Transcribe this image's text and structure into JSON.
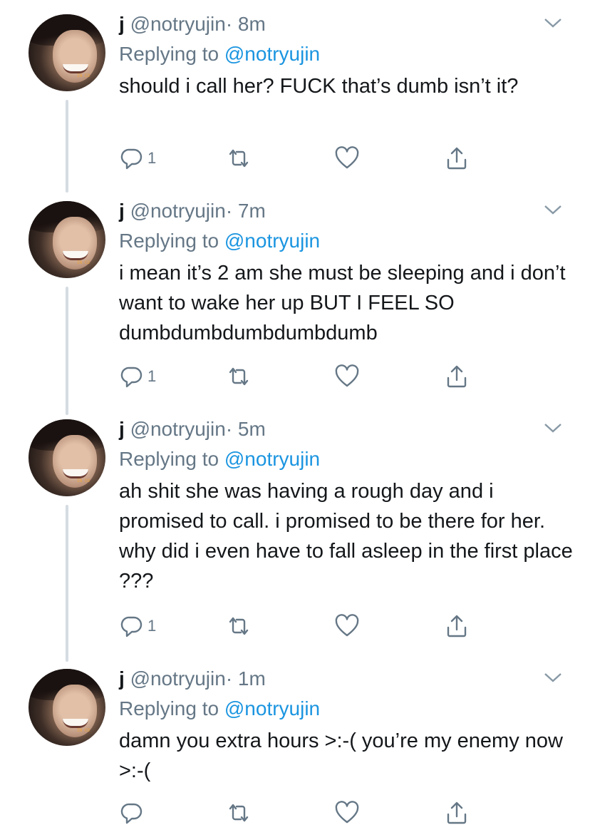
{
  "tweets": [
    {
      "name": "j",
      "handle": "@notryujin",
      "time": "· 8m",
      "replying_prefix": "Replying to",
      "replying_handle": "@notryujin",
      "text": "should i call her? FUCK that’s dumb isn’t it?",
      "reply_count": "1"
    },
    {
      "name": "j",
      "handle": "@notryujin",
      "time": "· 7m",
      "replying_prefix": "Replying to",
      "replying_handle": "@notryujin",
      "text": "i mean it’s 2 am she must be sleeping and i don’t want to wake her up BUT I FEEL SO dumbdumbdumbdumbdumb",
      "reply_count": "1"
    },
    {
      "name": "j",
      "handle": "@notryujin",
      "time": "· 5m",
      "replying_prefix": "Replying to",
      "replying_handle": "@notryujin",
      "text": "ah shit she was having a rough day and i promised to call. i promised to be there for her. why did i even have to fall asleep in the first place ???",
      "reply_count": "1"
    },
    {
      "name": "j",
      "handle": "@notryujin",
      "time": "· 1m",
      "replying_prefix": "Replying to",
      "replying_handle": "@notryujin",
      "text": "damn you extra hours >:-( you’re my enemy now >:-(",
      "reply_count": ""
    }
  ],
  "icons": {
    "reply": "reply-icon",
    "retweet": "retweet-icon",
    "like": "heart-icon",
    "share": "share-icon",
    "more": "chevron-down-icon"
  },
  "colors": {
    "text": "#14171a",
    "secondary": "#657786",
    "link": "#1b95e0",
    "thread_line": "#d5dce2"
  }
}
